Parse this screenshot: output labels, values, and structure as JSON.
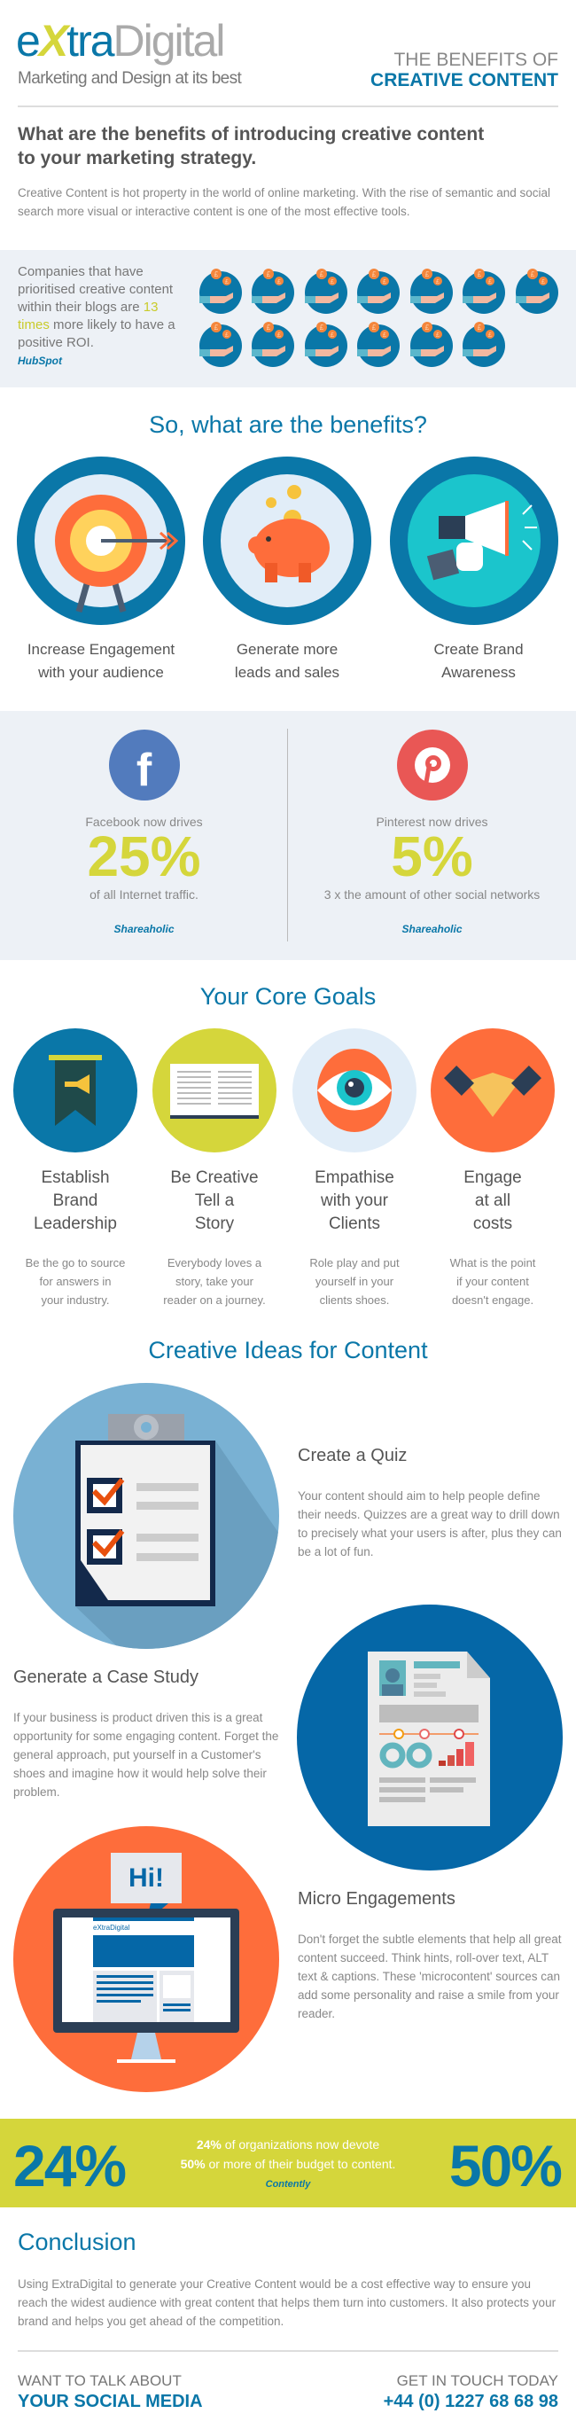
{
  "header": {
    "logo": {
      "part1": "e",
      "part2": "X",
      "part3": "tra",
      "part4": "Digital",
      "tagline": "Marketing and Design at its best"
    },
    "title_line1": "THE BENEFITS OF",
    "title_line2": "CREATIVE CONTENT"
  },
  "intro": {
    "heading_line1": "What are the benefits of introducing creative content",
    "heading_line2": "to your marketing strategy.",
    "body": "Creative Content is hot property in the world of online marketing. With the rise of semantic and social search more visual or interactive content is one of the most effective tools."
  },
  "roi": {
    "text_before": "Companies that have prioritised creative content within their blogs are ",
    "highlight": "13 times",
    "text_after": " more likely to have a positive ROI.",
    "source": "HubSpot",
    "icon_count": 13,
    "icon": "hand-with-pound-coins-icon"
  },
  "benefits": {
    "heading": "So, what are the benefits?",
    "items": [
      {
        "line1": "Increase Engagement",
        "line2": "with your audience",
        "icon": "target-arrow-icon"
      },
      {
        "line1": "Generate more",
        "line2": "leads and sales",
        "icon": "piggy-bank-icon"
      },
      {
        "line1": "Create Brand",
        "line2": "Awareness",
        "icon": "megaphone-icon"
      }
    ]
  },
  "social": [
    {
      "intro": "Facebook now drives",
      "value": "25%",
      "caption": "of all Internet traffic.",
      "source": "Shareaholic",
      "icon": "facebook-icon",
      "color": "#527bbd"
    },
    {
      "intro": "Pinterest now drives",
      "value": "5%",
      "caption": "3 x the amount of other social networks",
      "source": "Shareaholic",
      "icon": "pinterest-icon",
      "color": "#e95755"
    }
  ],
  "goals": {
    "heading": "Your Core Goals",
    "items": [
      {
        "title": [
          "Establish",
          "Brand",
          "Leadership"
        ],
        "desc": [
          "Be the go to source",
          "for answers in",
          "your industry."
        ],
        "icon": "banner-trumpet-icon",
        "color": "#0a77a8"
      },
      {
        "title": [
          "Be Creative",
          "Tell a",
          "Story"
        ],
        "desc": [
          "Everybody loves a",
          "story, take your",
          "reader on a journey."
        ],
        "icon": "open-book-icon",
        "color": "#d5d63b"
      },
      {
        "title": [
          "Empathise",
          "with your",
          "Clients"
        ],
        "desc": [
          "Role play and put",
          "yourself in your",
          "clients shoes."
        ],
        "icon": "eye-icon",
        "color": "#e1edf8"
      },
      {
        "title": [
          "Engage",
          "at all",
          "costs"
        ],
        "desc": [
          "What is the point",
          "if your content",
          "doesn't engage."
        ],
        "icon": "handshake-icon",
        "color": "#fe6d3b"
      }
    ]
  },
  "ideas": {
    "heading": "Creative Ideas for Content",
    "items": [
      {
        "title": "Create a Quiz",
        "body": "Your content should aim to help people define their needs. Quizzes are a great way to drill down to precisely what your users is after, plus they can be a lot of fun.",
        "icon": "clipboard-checklist-icon"
      },
      {
        "title": "Generate a Case Study",
        "body": "If your business is product driven this is a great opportunity for some engaging content. Forget the general approach, put yourself in a Customer's shoes and imagine how it would help solve their problem.",
        "icon": "report-document-icon"
      },
      {
        "title": "Micro Engagements",
        "body": "Don't forget the subtle elements that help all great content succeed. Think hints, roll-over text, ALT text & captions. These 'microcontent' sources can add some personality and raise a smile from your reader.",
        "icon": "monitor-hi-icon",
        "bubble": "Hi!",
        "screen_logo": "eXtraDigital"
      }
    ]
  },
  "budget": {
    "left_value": "24%",
    "right_value": "50%",
    "line1_bold": "24%",
    "line1_rest": " of organizations now devote",
    "line2_bold": "50%",
    "line2_rest": " or more of their budget to content.",
    "source": "Contently"
  },
  "conclusion": {
    "heading": "Conclusion",
    "body": "Using ExtraDigital to generate your Creative Content would be a cost effective way to ensure you reach the widest audience with great content that helps them turn into customers. It also protects your brand and helps you get ahead of the competition."
  },
  "footer": {
    "left_line1": "WANT TO TALK ABOUT",
    "left_line2": "YOUR SOCIAL MEDIA",
    "right_line1": "GET IN TOUCH TODAY",
    "right_line2": "+44 (0) 1227 68 68 98"
  },
  "colors": {
    "brand_blue": "#0a77a8",
    "accent_yellow": "#d5d63b",
    "orange": "#fe6d3b",
    "band_gray": "#edf1f6"
  }
}
